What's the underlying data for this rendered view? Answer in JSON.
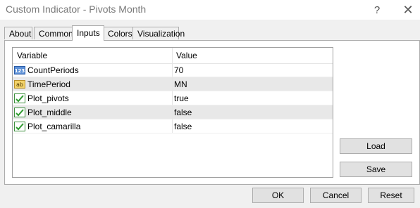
{
  "window": {
    "title": "Custom Indicator - Pivots Month",
    "help_glyph": "?",
    "close_glyph": "✕"
  },
  "tabs": [
    {
      "label": "About",
      "active": false
    },
    {
      "label": "Common",
      "active": false
    },
    {
      "label": "Inputs",
      "active": true
    },
    {
      "label": "Colors",
      "active": false
    },
    {
      "label": "Visualization",
      "active": false
    }
  ],
  "grid": {
    "columns": [
      "Variable",
      "Value"
    ],
    "rows": [
      {
        "icon": "integer-icon",
        "name": "CountPeriods",
        "value": "70",
        "selected": false
      },
      {
        "icon": "string-icon",
        "name": "TimePeriod",
        "value": "MN",
        "selected": true
      },
      {
        "icon": "boolean-icon",
        "name": "Plot_pivots",
        "value": "true",
        "selected": false
      },
      {
        "icon": "boolean-icon",
        "name": "Plot_middle",
        "value": "false",
        "selected": true
      },
      {
        "icon": "boolean-icon",
        "name": "Plot_camarilla",
        "value": "false",
        "selected": false
      }
    ]
  },
  "buttons": {
    "load": "Load",
    "save": "Save",
    "ok": "OK",
    "cancel": "Cancel",
    "reset": "Reset"
  }
}
